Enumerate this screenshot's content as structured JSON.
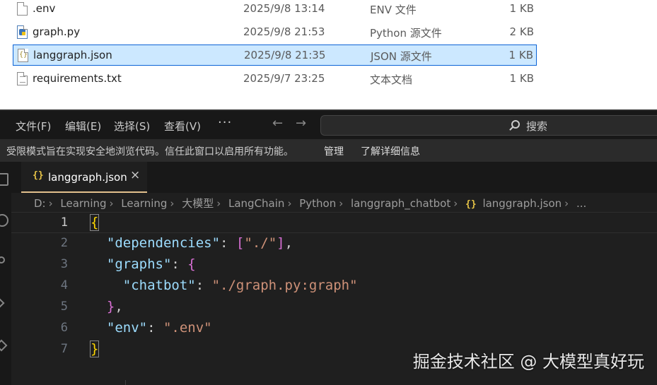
{
  "explorer": {
    "files": [
      {
        "icon": "file-icon",
        "name": ".env",
        "date": "2025/9/8 13:14",
        "type": "ENV 文件",
        "size": "1 KB"
      },
      {
        "icon": "python-file-icon",
        "name": "graph.py",
        "date": "2025/9/8 21:53",
        "type": "Python 源文件",
        "size": "2 KB"
      },
      {
        "icon": "json-file-icon",
        "name": "langgraph.json",
        "date": "2025/9/8 21:35",
        "type": "JSON 源文件",
        "size": "1 KB"
      },
      {
        "icon": "text-file-icon",
        "name": "requirements.txt",
        "date": "2025/9/7 23:25",
        "type": "文本文档",
        "size": "1 KB"
      }
    ]
  },
  "titlebar": {
    "menu": [
      "文件(F)",
      "编辑(E)",
      "选择(S)",
      "查看(V)"
    ],
    "more": "···",
    "back_arrow": "←",
    "forward_arrow": "→",
    "search_label": "搜索"
  },
  "restricted": {
    "message": "受限模式旨在实现安全地浏览代码。信任此窗口以启用所有功能。",
    "manage": "管理",
    "learn_more": "了解详细信息"
  },
  "tab": {
    "icon": "{}",
    "label": "langgraph.json",
    "close": "×"
  },
  "breadcrumb": {
    "items": [
      "D:",
      "Learning",
      "Learning",
      "大模型",
      "LangChain",
      "Python",
      "langgraph_chatbot"
    ],
    "file_icon": "{}",
    "file": "langgraph.json",
    "ellipsis": "..."
  },
  "editor": {
    "line_numbers": [
      "1",
      "2",
      "3",
      "4",
      "5",
      "6",
      "7"
    ],
    "key_dependencies": "\"dependencies\"",
    "val_dependencies": "\"./\"",
    "key_graphs": "\"graphs\"",
    "key_chatbot": "\"chatbot\"",
    "val_chatbot": "\"./graph.py:graph\"",
    "key_env": "\"env\"",
    "val_env": "\".env\""
  },
  "watermark": "掘金技术社区 @ 大模型真好玩"
}
